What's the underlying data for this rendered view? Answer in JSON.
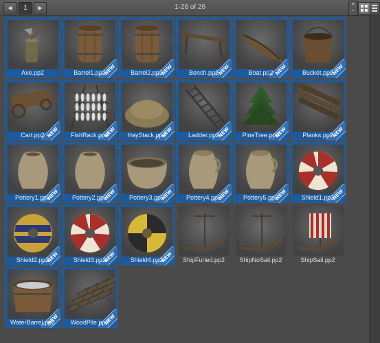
{
  "toolbar": {
    "prev_icon": "prev-arrow-icon",
    "next_icon": "next-arrow-icon",
    "page_number": "1",
    "page_info": "1-26 of 26",
    "zoom_plus": "+",
    "zoom_minus": "-"
  },
  "colors": {
    "selected_tile": "#1d5a9c",
    "new_badge": "#2f6fb5",
    "background": "#4a4a4a"
  },
  "items": [
    {
      "label": "Axe.pp2",
      "new": false,
      "selected": true,
      "icon": "axe"
    },
    {
      "label": "Barrel1.pp2",
      "new": true,
      "selected": true,
      "icon": "barrel"
    },
    {
      "label": "Barrel2.pp2",
      "new": true,
      "selected": true,
      "icon": "barrel"
    },
    {
      "label": "Bench.pp2",
      "new": true,
      "selected": true,
      "icon": "bench"
    },
    {
      "label": "Boat.pp2",
      "new": true,
      "selected": true,
      "icon": "boat"
    },
    {
      "label": "Bucket.pp2",
      "new": true,
      "selected": true,
      "icon": "bucket"
    },
    {
      "label": "Cart.pp2",
      "new": true,
      "selected": true,
      "icon": "cart"
    },
    {
      "label": "FishRack.pp2",
      "new": true,
      "selected": true,
      "icon": "fishrack"
    },
    {
      "label": "HayStack.pp2",
      "new": true,
      "selected": true,
      "icon": "haystack"
    },
    {
      "label": "Ladder.pp2",
      "new": true,
      "selected": true,
      "icon": "ladder"
    },
    {
      "label": "PineTree.pp2",
      "new": true,
      "selected": true,
      "icon": "pinetree"
    },
    {
      "label": "Planks.pp2",
      "new": true,
      "selected": true,
      "icon": "planks"
    },
    {
      "label": "Pottery1.pp2",
      "new": true,
      "selected": true,
      "icon": "pot"
    },
    {
      "label": "Pottery2.pp2",
      "new": true,
      "selected": true,
      "icon": "pot"
    },
    {
      "label": "Pottery3.pp2",
      "new": true,
      "selected": true,
      "icon": "bowl"
    },
    {
      "label": "Pottery4.pp2",
      "new": true,
      "selected": true,
      "icon": "jug"
    },
    {
      "label": "Pottery5.pp2",
      "new": true,
      "selected": true,
      "icon": "jug"
    },
    {
      "label": "Shield1.pp2",
      "new": true,
      "selected": true,
      "icon": "shield-red"
    },
    {
      "label": "Shield2.pp2",
      "new": true,
      "selected": true,
      "icon": "shield-blue"
    },
    {
      "label": "Shield3.pp2",
      "new": true,
      "selected": true,
      "icon": "shield-red"
    },
    {
      "label": "Shield4.pp2",
      "new": true,
      "selected": true,
      "icon": "shield-yellow"
    },
    {
      "label": "ShipFurled.pp2",
      "new": false,
      "selected": false,
      "icon": "ship"
    },
    {
      "label": "ShipNoSail.pp2",
      "new": false,
      "selected": false,
      "icon": "ship"
    },
    {
      "label": "ShipSail.pp2",
      "new": false,
      "selected": false,
      "icon": "shipsail"
    },
    {
      "label": "WaterBarrel.pp2",
      "new": true,
      "selected": true,
      "icon": "waterbarrel"
    },
    {
      "label": "WoodPile.pp2",
      "new": true,
      "selected": true,
      "icon": "woodpile"
    }
  ],
  "new_badge_text": "NEW"
}
